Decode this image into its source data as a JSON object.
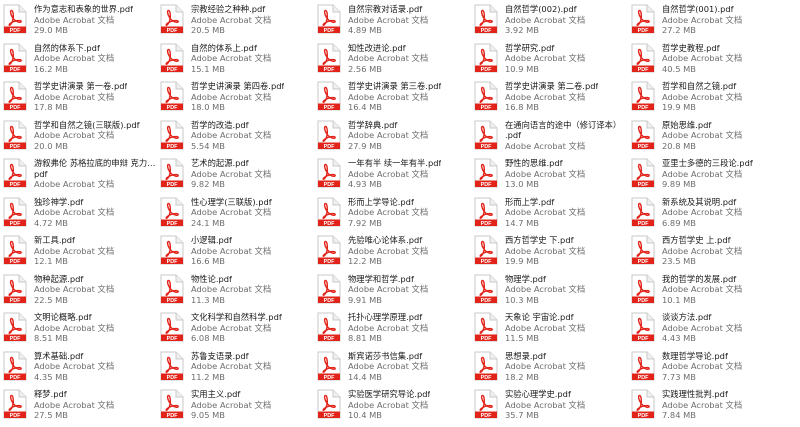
{
  "files": [
    {
      "name": "作为意志和表象的世界.pdf",
      "type": "Adobe Acrobat 文档",
      "size": "29.0 MB"
    },
    {
      "name": "宗教经验之种种.pdf",
      "type": "Adobe Acrobat 文档",
      "size": "20.5 MB"
    },
    {
      "name": "自然宗教对话录.pdf",
      "type": "Adobe Acrobat 文档",
      "size": "4.89 MB"
    },
    {
      "name": "自然哲学(002).pdf",
      "type": "Adobe Acrobat 文档",
      "size": "3.92 MB"
    },
    {
      "name": "自然哲学(001).pdf",
      "type": "Adobe Acrobat 文档",
      "size": "27.2 MB"
    },
    {
      "name": "自然的体系下.pdf",
      "type": "Adobe Acrobat 文档",
      "size": "16.2 MB"
    },
    {
      "name": "自然的体系上.pdf",
      "type": "Adobe Acrobat 文档",
      "size": "15.1 MB"
    },
    {
      "name": "知性改进论.pdf",
      "type": "Adobe Acrobat 文档",
      "size": "2.56 MB"
    },
    {
      "name": "哲学研究.pdf",
      "type": "Adobe Acrobat 文档",
      "size": "10.9 MB"
    },
    {
      "name": "哲学史教程.pdf",
      "type": "Adobe Acrobat 文档",
      "size": "40.5 MB"
    },
    {
      "name": "哲学史讲演录 第一卷.pdf",
      "type": "Adobe Acrobat 文档",
      "size": "17.8 MB"
    },
    {
      "name": "哲学史讲演录 第四卷.pdf",
      "type": "Adobe Acrobat 文档",
      "size": "18.0 MB"
    },
    {
      "name": "哲学史讲演录 第三卷.pdf",
      "type": "Adobe Acrobat 文档",
      "size": "16.4 MB"
    },
    {
      "name": "哲学史讲演录 第二卷.pdf",
      "type": "Adobe Acrobat 文档",
      "size": "16.8 MB"
    },
    {
      "name": "哲学和自然之镜.pdf",
      "type": "Adobe Acrobat 文档",
      "size": "19.9 MB"
    },
    {
      "name": "哲学和自然之镜(三联版).pdf",
      "type": "Adobe Acrobat 文档",
      "size": "20.0 MB"
    },
    {
      "name": "哲学的改造.pdf",
      "type": "Adobe Acrobat 文档",
      "size": "5.54 MB"
    },
    {
      "name": "哲学辞典.pdf",
      "type": "Adobe Acrobat 文档",
      "size": "27.9 MB"
    },
    {
      "name": "在通向语言的途中（修订译本）",
      "name2": ".pdf",
      "type": "Adobe Acrobat 文档",
      "size": ""
    },
    {
      "name": "原始思维.pdf",
      "type": "Adobe Acrobat 文档",
      "size": "20.8 MB"
    },
    {
      "name": "游叙弗伦 苏格拉底的申辩 克力同.",
      "name2": "pdf",
      "type": "Adobe Acrobat 文档",
      "size": ""
    },
    {
      "name": "艺术的起源.pdf",
      "type": "Adobe Acrobat 文档",
      "size": "9.82 MB"
    },
    {
      "name": "一年有半 续一年有半.pdf",
      "type": "Adobe Acrobat 文档",
      "size": "4.93 MB"
    },
    {
      "name": "野性的思维.pdf",
      "type": "Adobe Acrobat 文档",
      "size": "13.0 MB"
    },
    {
      "name": "亚里士多德的三段论.pdf",
      "type": "Adobe Acrobat 文档",
      "size": "9.89 MB"
    },
    {
      "name": "独珍神学.pdf",
      "type": "Adobe Acrobat 文档",
      "size": "4.72 MB"
    },
    {
      "name": "性心理学(三联版).pdf",
      "type": "Adobe Acrobat 文档",
      "size": "24.1 MB"
    },
    {
      "name": "形而上学导论.pdf",
      "type": "Adobe Acrobat 文档",
      "size": "7.92 MB"
    },
    {
      "name": "形而上学.pdf",
      "type": "Adobe Acrobat 文档",
      "size": "14.7 MB"
    },
    {
      "name": "新系统及其说明.pdf",
      "type": "Adobe Acrobat 文档",
      "size": "6.89 MB"
    },
    {
      "name": "新工具.pdf",
      "type": "Adobe Acrobat 文档",
      "size": "12.1 MB"
    },
    {
      "name": "小逻辑.pdf",
      "type": "Adobe Acrobat 文档",
      "size": "16.6 MB"
    },
    {
      "name": "先验唯心论体系.pdf",
      "type": "Adobe Acrobat 文档",
      "size": "12.2 MB"
    },
    {
      "name": "西方哲学史 下.pdf",
      "type": "Adobe Acrobat 文档",
      "size": "19.9 MB"
    },
    {
      "name": "西方哲学史 上.pdf",
      "type": "Adobe Acrobat 文档",
      "size": "23.5 MB"
    },
    {
      "name": "物种起源.pdf",
      "type": "Adobe Acrobat 文档",
      "size": "22.5 MB"
    },
    {
      "name": "物性论.pdf",
      "type": "Adobe Acrobat 文档",
      "size": "11.3 MB"
    },
    {
      "name": "物理学和哲学.pdf",
      "type": "Adobe Acrobat 文档",
      "size": "9.91 MB"
    },
    {
      "name": "物理学.pdf",
      "type": "Adobe Acrobat 文档",
      "size": "10.3 MB"
    },
    {
      "name": "我的哲学的发展.pdf",
      "type": "Adobe Acrobat 文档",
      "size": "10.1 MB"
    },
    {
      "name": "文明论概略.pdf",
      "type": "Adobe Acrobat 文档",
      "size": "8.51 MB"
    },
    {
      "name": "文化科学和自然科学.pdf",
      "type": "Adobe Acrobat 文档",
      "size": "6.08 MB"
    },
    {
      "name": "托扑心理学原理.pdf",
      "type": "Adobe Acrobat 文档",
      "size": "8.81 MB"
    },
    {
      "name": "天象论 宇宙论.pdf",
      "type": "Adobe Acrobat 文档",
      "size": "11.5 MB"
    },
    {
      "name": "谈谈方法.pdf",
      "type": "Adobe Acrobat 文档",
      "size": "4.43 MB"
    },
    {
      "name": "算术基础.pdf",
      "type": "Adobe Acrobat 文档",
      "size": "4.35 MB"
    },
    {
      "name": "苏鲁支语录.pdf",
      "type": "Adobe Acrobat 文档",
      "size": "11.2 MB"
    },
    {
      "name": "斯宾诺莎书信集.pdf",
      "type": "Adobe Acrobat 文档",
      "size": "14.4 MB"
    },
    {
      "name": "思想录.pdf",
      "type": "Adobe Acrobat 文档",
      "size": "18.2 MB"
    },
    {
      "name": "数理哲学导论.pdf",
      "type": "Adobe Acrobat 文档",
      "size": "7.73 MB"
    },
    {
      "name": "释梦.pdf",
      "type": "Adobe Acrobat 文档",
      "size": "27.5 MB"
    },
    {
      "name": "实用主义.pdf",
      "type": "Adobe Acrobat 文档",
      "size": "9.05 MB"
    },
    {
      "name": "实验医学研究导论.pdf",
      "type": "Adobe Acrobat 文档",
      "size": "10.4 MB"
    },
    {
      "name": "实验心理学史.pdf",
      "type": "Adobe Acrobat 文档",
      "size": "35.7 MB"
    },
    {
      "name": "实践理性批判.pdf",
      "type": "Adobe Acrobat 文档",
      "size": "7.84 MB"
    }
  ],
  "colors": {
    "pdf_red": "#e2231a",
    "text": "#1a1a1a",
    "muted": "#6d6d6d"
  },
  "icon": "pdf-file-icon"
}
